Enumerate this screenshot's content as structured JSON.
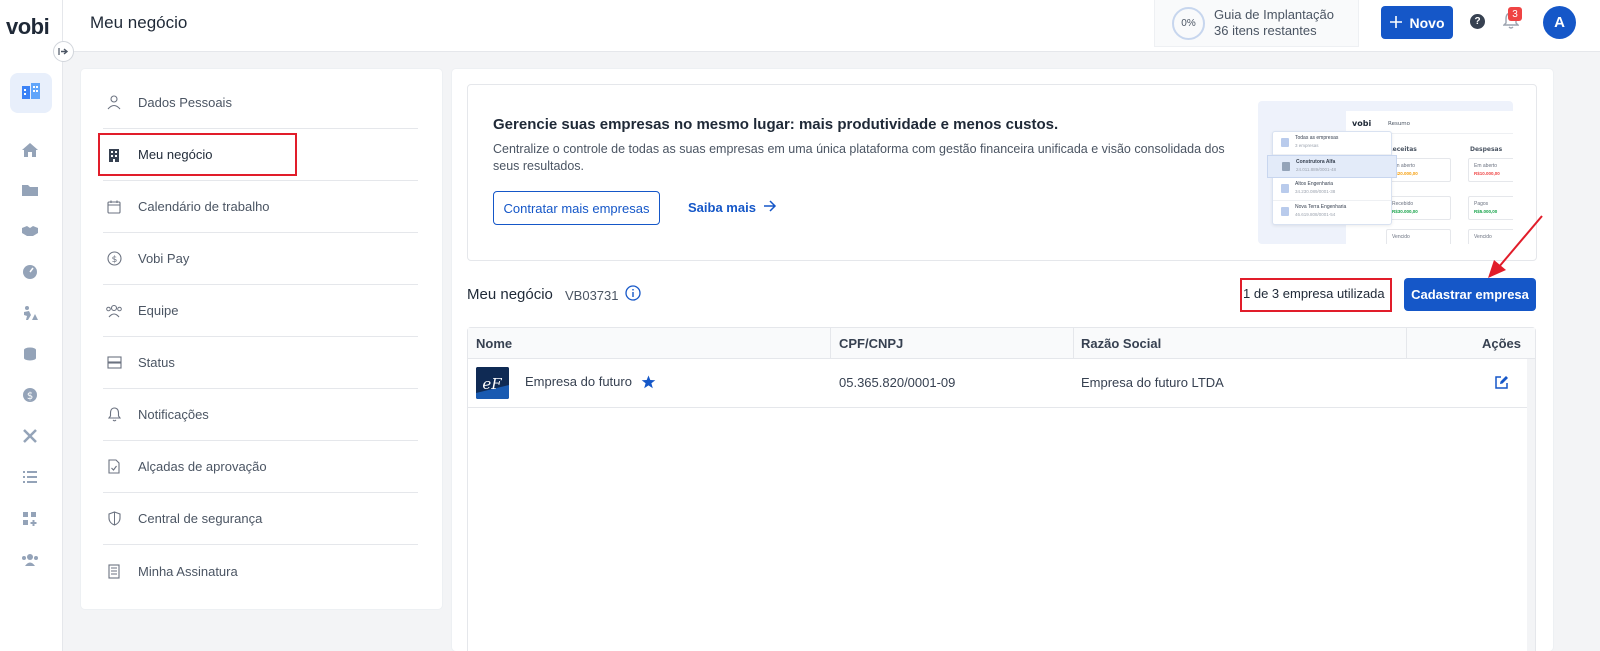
{
  "app": {
    "logo": "vobi",
    "page_title": "Meu negócio"
  },
  "topbar": {
    "guide_percent": "0%",
    "guide_title": "Guia de Implantação",
    "guide_sub": "36 itens restantes",
    "new_label": "Novo",
    "help_label": "?",
    "notifications_count": "3",
    "avatar_initial": "A"
  },
  "rail": {
    "icons": [
      "business-icon",
      "home-icon",
      "folder-icon",
      "handshake-icon",
      "gauge-icon",
      "worker-icon",
      "coins-icon",
      "dollar-icon",
      "tools-icon",
      "list-icon",
      "grid-plus-icon",
      "users-icon"
    ]
  },
  "menu": {
    "items": [
      {
        "label": "Dados Pessoais",
        "icon": "user-icon"
      },
      {
        "label": "Meu negócio",
        "icon": "building-icon"
      },
      {
        "label": "Calendário de trabalho",
        "icon": "calendar-icon"
      },
      {
        "label": "Vobi Pay",
        "icon": "coin-icon"
      },
      {
        "label": "Equipe",
        "icon": "team-icon"
      },
      {
        "label": "Status",
        "icon": "status-icon"
      },
      {
        "label": "Notificações",
        "icon": "bell-icon"
      },
      {
        "label": "Alçadas de aprovação",
        "icon": "approval-doc-icon"
      },
      {
        "label": "Central de segurança",
        "icon": "shield-icon"
      },
      {
        "label": "Minha Assinatura",
        "icon": "receipt-icon"
      }
    ]
  },
  "promo": {
    "title": "Gerencie suas empresas no mesmo lugar: mais produtividade e menos custos.",
    "description": "Centralize o controle de todas as suas empresas em uma única plataforma com gestão financeira unificada e visão consolidada dos seus resultados.",
    "cta_label": "Contratar mais empresas",
    "link_label": "Saiba mais",
    "illustration": {
      "logo": "vobi",
      "header": "Resumo",
      "col_receitas": "Receitas",
      "col_despesas": "Despesas",
      "companies": [
        {
          "name": "Todas as empresas",
          "sub": "3 empresas"
        },
        {
          "name": "Construtora Alfa",
          "sub": "24.011.889/0001-48"
        },
        {
          "name": "Altos Engenharia",
          "sub": "34.230.089/0001-38"
        },
        {
          "name": "Nova Terra Engenharia",
          "sub": "46.619.808/0001-54"
        }
      ],
      "cards": [
        {
          "label": "Em aberto",
          "value": "R$20.000,00",
          "color": "#f59e0b"
        },
        {
          "label": "Em aberto",
          "value": "R$10.000,00",
          "color": "#ef4444"
        },
        {
          "label": "Recebido",
          "value": "R$30.000,00",
          "color": "#16a34a"
        },
        {
          "label": "Pagos",
          "value": "R$5.000,00",
          "color": "#16a34a"
        },
        {
          "label": "Vencido",
          "value": "",
          "color": "#6b7280"
        },
        {
          "label": "Vencido",
          "value": "",
          "color": "#6b7280"
        }
      ]
    }
  },
  "business": {
    "title": "Meu negócio",
    "code": "VB03731",
    "usage": "1 de 3 empresa utilizada",
    "add_label": "Cadastrar empresa"
  },
  "table": {
    "headers": [
      "Nome",
      "CPF/CNPJ",
      "Razão Social",
      "Ações"
    ],
    "rows": [
      {
        "logo_text": "eF",
        "name": "Empresa do futuro",
        "document": "05.365.820/0001-09",
        "legal_name": "Empresa do futuro LTDA"
      }
    ]
  },
  "colors": {
    "primary": "#1557c8",
    "highlight": "#e11d2a",
    "star": "#1557c8"
  }
}
